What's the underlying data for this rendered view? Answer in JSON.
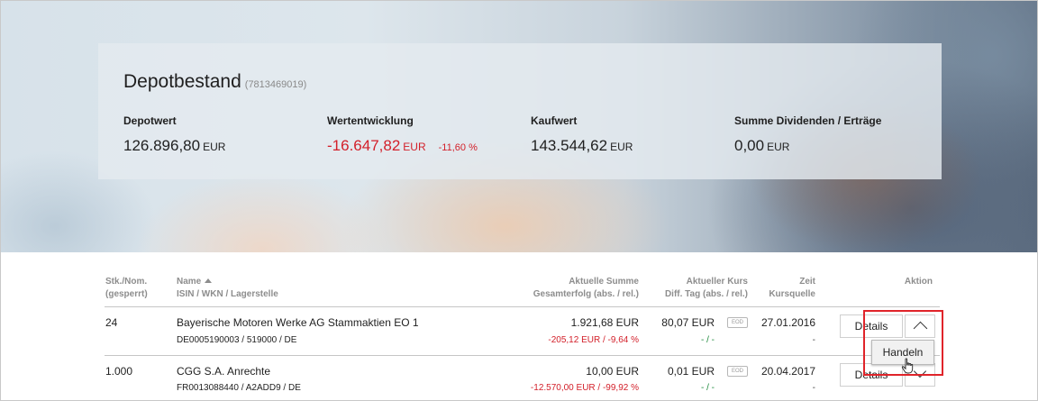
{
  "depot": {
    "title": "Depotbestand",
    "account": "(7813469019)",
    "kpis": [
      {
        "label": "Depotwert",
        "value": "126.896,80",
        "currency": "EUR"
      },
      {
        "label": "Wertentwicklung",
        "value": "-16.647,82",
        "currency": "EUR",
        "percent": "-11,60 %"
      },
      {
        "label": "Kaufwert",
        "value": "143.544,62",
        "currency": "EUR"
      },
      {
        "label": "Summe Dividenden / Erträge",
        "value": "0,00",
        "currency": "EUR"
      }
    ]
  },
  "table": {
    "headers": {
      "qty": [
        "Stk./Nom.",
        "(gesperrt)"
      ],
      "name": [
        "Name",
        "ISIN / WKN / Lagerstelle"
      ],
      "sum": [
        "Aktuelle Summe",
        "Gesamterfolg (abs. / rel.)"
      ],
      "price": [
        "Aktueller Kurs",
        "Diff. Tag (abs. / rel.)"
      ],
      "time": [
        "Zeit",
        "Kursquelle"
      ],
      "action": "Aktion"
    },
    "rows": [
      {
        "qty": "24",
        "name": "Bayerische Motoren Werke AG Stammaktien EO 1",
        "ids": "DE0005190003 / 519000 / DE",
        "sum": "1.921,68 EUR",
        "gain": "-205,12 EUR / -9,64 %",
        "price": "80,07 EUR",
        "source_badge": "EOD",
        "diff": "- / -",
        "date": "27.01.2016",
        "source": "-",
        "details_label": "Details"
      },
      {
        "qty": "1.000",
        "name": "CGG S.A. Anrechte",
        "ids": "FR0013088440 / A2ADD9 / DE",
        "sum": "10,00 EUR",
        "gain": "-12.570,00 EUR / -99,92 %",
        "price": "0,01 EUR",
        "source_badge": "EOD",
        "diff": "- / -",
        "date": "20.04.2017",
        "source": "-",
        "details_label": "Details"
      }
    ],
    "dropdown": {
      "item": "Handeln"
    }
  },
  "colors": {
    "negative": "#d3202a",
    "neutral_change": "#1e8a3c",
    "highlight": "#e0242a"
  }
}
